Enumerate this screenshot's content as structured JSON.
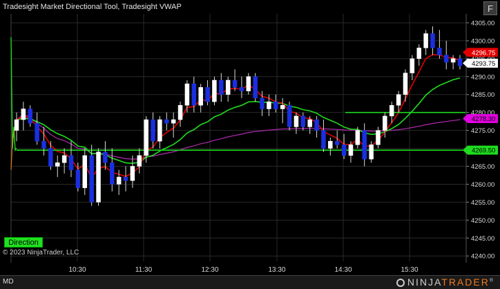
{
  "title": "Tradesight Market Directional Tool, Tradesight VWAP",
  "f_button": "F",
  "copyright": "© 2023 NinjaTrader, LLC",
  "direction_label": "Direction",
  "status_text": "MD",
  "logo": {
    "part1": "NINJA",
    "part2": "TRADER",
    "suffix": "®"
  },
  "colors": {
    "background": "#000000",
    "up_candle": "#ffffff",
    "down_candle": "#1a2fe0",
    "red_line": "#e00000",
    "green_line": "#1fdc1f",
    "magenta_line": "#b22ab2",
    "grid": "#2a2a2a"
  },
  "y_axis_ticks": [
    "4305.00",
    "4300.00",
    "4295.00",
    "4290.00",
    "4285.00",
    "4280.00",
    "4275.00",
    "4270.00",
    "4265.00",
    "4260.00",
    "4255.00",
    "4250.00",
    "4245.00",
    "4240.00"
  ],
  "x_axis_ticks": [
    "10:30",
    "11:30",
    "12:30",
    "13:30",
    "14:30",
    "15:30"
  ],
  "price_tags": [
    {
      "label": "4296.75",
      "bg": "#e00000",
      "fg": "#ffffff",
      "price": 4296.75
    },
    {
      "label": "4293.75",
      "bg": "#ffffff",
      "fg": "#000000",
      "price": 4293.75
    },
    {
      "label": "4278.30",
      "bg": "#e000e0",
      "fg": "#000000",
      "price": 4278.3
    },
    {
      "label": "4269.50",
      "bg": "#1fdc1f",
      "fg": "#000000",
      "price": 4269.5
    }
  ],
  "chart_data": {
    "type": "candlestick",
    "ylim": [
      4238.5,
      4307.5
    ],
    "candles": [
      [
        4275,
        4280,
        4272,
        4278
      ],
      [
        4278,
        4283,
        4275,
        4281
      ],
      [
        4281,
        4282,
        4276,
        4277
      ],
      [
        4277,
        4280,
        4271,
        4272
      ],
      [
        4272,
        4276,
        4268,
        4270
      ],
      [
        4270,
        4272,
        4264,
        4265
      ],
      [
        4265,
        4268,
        4262,
        4266
      ],
      [
        4266,
        4270,
        4263,
        4268
      ],
      [
        4268,
        4272,
        4262,
        4264
      ],
      [
        4264,
        4266,
        4258,
        4259
      ],
      [
        4259,
        4270,
        4257,
        4268
      ],
      [
        4268,
        4271,
        4254,
        4255
      ],
      [
        4255,
        4270,
        4254,
        4269
      ],
      [
        4269,
        4272,
        4264,
        4266
      ],
      [
        4266,
        4270,
        4258,
        4260
      ],
      [
        4260,
        4264,
        4257,
        4262
      ],
      [
        4262,
        4265,
        4258,
        4261
      ],
      [
        4261,
        4268,
        4259,
        4265
      ],
      [
        4265,
        4270,
        4263,
        4268
      ],
      [
        4268,
        4279,
        4266,
        4278
      ],
      [
        4278,
        4280,
        4270,
        4272
      ],
      [
        4272,
        4279,
        4270,
        4278
      ],
      [
        4278,
        4280,
        4275,
        4277
      ],
      [
        4277,
        4280,
        4273,
        4278
      ],
      [
        4278,
        4283,
        4276,
        4282
      ],
      [
        4282,
        4289,
        4280,
        4288
      ],
      [
        4288,
        4290,
        4280,
        4282
      ],
      [
        4282,
        4288,
        4280,
        4287
      ],
      [
        4287,
        4289,
        4282,
        4283
      ],
      [
        4283,
        4290,
        4282,
        4289
      ],
      [
        4289,
        4291,
        4283,
        4285
      ],
      [
        4285,
        4290,
        4283,
        4289
      ],
      [
        4289,
        4292,
        4286,
        4287
      ],
      [
        4287,
        4290,
        4284,
        4286
      ],
      [
        4286,
        4291,
        4285,
        4290
      ],
      [
        4290,
        4291,
        4283,
        4284
      ],
      [
        4284,
        4286,
        4279,
        4281
      ],
      [
        4281,
        4285,
        4279,
        4283
      ],
      [
        4283,
        4285,
        4280,
        4281
      ],
      [
        4281,
        4284,
        4277,
        4282
      ],
      [
        4282,
        4283,
        4275,
        4276
      ],
      [
        4276,
        4280,
        4274,
        4279
      ],
      [
        4279,
        4280,
        4275,
        4276
      ],
      [
        4276,
        4279,
        4274,
        4278
      ],
      [
        4278,
        4279,
        4273,
        4275
      ],
      [
        4275,
        4278,
        4269,
        4270
      ],
      [
        4270,
        4273,
        4268,
        4272
      ],
      [
        4272,
        4275,
        4270,
        4271
      ],
      [
        4271,
        4274,
        4267,
        4268
      ],
      [
        4268,
        4272,
        4266,
        4271
      ],
      [
        4271,
        4276,
        4270,
        4275
      ],
      [
        4275,
        4277,
        4265,
        4267
      ],
      [
        4267,
        4272,
        4266,
        4271
      ],
      [
        4271,
        4276,
        4270,
        4275
      ],
      [
        4275,
        4280,
        4273,
        4279
      ],
      [
        4279,
        4283,
        4277,
        4282
      ],
      [
        4282,
        4286,
        4280,
        4285
      ],
      [
        4285,
        4292,
        4283,
        4291
      ],
      [
        4291,
        4296,
        4289,
        4295
      ],
      [
        4295,
        4299,
        4293,
        4298
      ],
      [
        4298,
        4303,
        4296,
        4302
      ],
      [
        4302,
        4304,
        4296,
        4298
      ],
      [
        4298,
        4303,
        4295,
        4296
      ],
      [
        4296,
        4300,
        4292,
        4294
      ],
      [
        4294,
        4296,
        4292,
        4295
      ],
      [
        4295,
        4296,
        4292,
        4293
      ]
    ],
    "direction_line_levels": [
      {
        "color": "#1fdc1f",
        "price": 4269.5
      },
      {
        "color": "#1fdc1f",
        "price": 4280.0
      }
    ]
  }
}
